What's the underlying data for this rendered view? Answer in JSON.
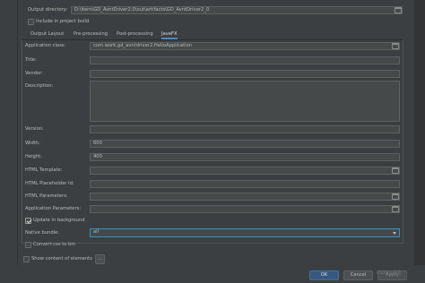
{
  "header": {
    "output_directory_label": "Output directory:",
    "output_directory_value": "D:\\itern\\GD_AvntDriver2.0\\out\\artifacts\\GD_AvntDriver2_0",
    "include_in_build_label": "Include in project build",
    "include_in_build_checked": false
  },
  "tabs": [
    {
      "label": "Output Layout",
      "active": false
    },
    {
      "label": "Pre-processing",
      "active": false
    },
    {
      "label": "Post-processing",
      "active": false
    },
    {
      "label": "JavaFX",
      "active": true
    }
  ],
  "form": {
    "application_class_label": "Application class:",
    "application_class_value": "com.work.gd_avntdriver2.HelloApplication",
    "title_label": "Title:",
    "title_value": "",
    "vendor_label": "Vendor:",
    "vendor_value": "",
    "description_label": "Description:",
    "description_value": "",
    "version_label": "Version:",
    "version_value": "",
    "width_label": "Width:",
    "width_value": "600",
    "height_label": "Height:",
    "height_value": "400",
    "html_template_label": "HTML Template:",
    "html_template_value": "",
    "html_placeholder_label": "HTML Placeholder Id:",
    "html_placeholder_value": "",
    "html_parameters_label": "HTML Parameters:",
    "html_parameters_value": "",
    "application_parameters_label": "Application Parameters:",
    "application_parameters_value": "",
    "update_in_background_label": "Update in background",
    "update_in_background_checked": true,
    "native_bundle_label": "Native bundle:",
    "native_bundle_value": "all",
    "convert_css_label": "Convert css to bin",
    "convert_css_checked": false
  },
  "footer": {
    "show_content_label": "Show content of elements",
    "show_content_checked": false,
    "more_button_label": "...",
    "ok_label": "OK",
    "cancel_label": "Cancel",
    "apply_label": "Apply",
    "watermark": "CSDN @逆是"
  },
  "colors": {
    "background": "#3c3f41",
    "field": "#45494a",
    "focus_border": "#3592c4",
    "tab_underline": "#4a88c7",
    "primary_button": "#365880"
  },
  "icons": [
    "folder-icon",
    "check-icon",
    "chevron-down-icon"
  ]
}
